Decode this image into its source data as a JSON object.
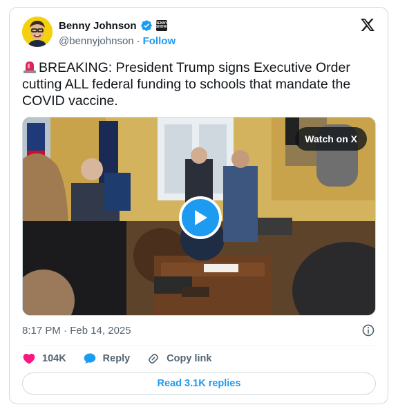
{
  "author": {
    "display_name": "Benny Johnson",
    "handle": "@bennyjohnson",
    "follow_label": "Follow",
    "separator": "·",
    "affiliate_badge_text": "BENNY SHOW"
  },
  "tweet": {
    "text": "BREAKING: President Trump signs Executive Order cutting ALL federal funding to schools that mandate the COVID vaccine.",
    "timestamp": "8:17 PM · Feb 14, 2025"
  },
  "media": {
    "watch_label": "Watch on X",
    "type": "video"
  },
  "actions": {
    "likes_count": "104K",
    "reply_label": "Reply",
    "copy_link_label": "Copy link"
  },
  "footer": {
    "read_replies_label": "Read 3.1K replies"
  },
  "colors": {
    "accent": "#1d9bf0",
    "like": "#f91880",
    "text_primary": "#0f1419",
    "text_secondary": "#536471",
    "border": "#cfd9de"
  },
  "icons": [
    "siren-icon",
    "verified-badge-icon",
    "x-logo-icon",
    "play-icon",
    "info-icon",
    "heart-icon",
    "reply-bubble-icon",
    "link-icon"
  ]
}
